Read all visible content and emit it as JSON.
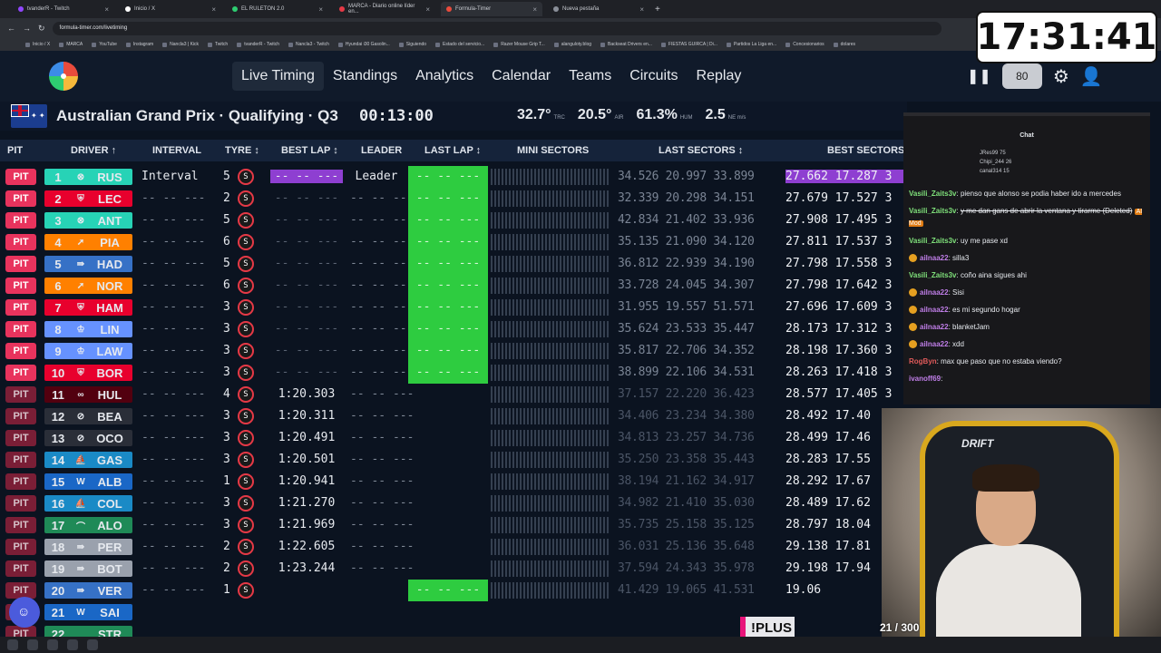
{
  "browser": {
    "tabs": [
      {
        "label": "tvanderR - Twitch",
        "color": "#9146ff",
        "active": false
      },
      {
        "label": "Inicio / X",
        "color": "#ffffff",
        "active": false
      },
      {
        "label": "EL RULETON 2.0",
        "color": "#2ecc71",
        "active": false
      },
      {
        "label": "MARCA - Diario online líder en...",
        "color": "#e63946",
        "active": false
      },
      {
        "label": "Formula-Timer",
        "color": "#e94b3c",
        "active": true
      },
      {
        "label": "Nueva pestaña",
        "color": "#8a8f99",
        "active": false
      }
    ],
    "url": "formula-timer.com/livetiming",
    "bookmarks": [
      "Inicio / X",
      "MARCA",
      "YouTube",
      "Instagram",
      "Nancla3 | Kick",
      "Twitch",
      "tvanderR - Twitch",
      "Nancla3 - Twitch",
      "Hyundai i30 Gasolin...",
      "Siguiendo",
      "Estado del servicio...",
      "Razer Mouse Grip T...",
      "alanguloty.blog",
      "Backseat Drivers en...",
      "FIESTAS GUIRCA | Di...",
      "Partidos La Liga en...",
      "Concesionarios",
      "dolares"
    ]
  },
  "nav": {
    "links": [
      "Live Timing",
      "Standings",
      "Analytics",
      "Calendar",
      "Teams",
      "Circuits",
      "Replay"
    ],
    "speed": "80"
  },
  "overlay_clock": "17:31:41",
  "session": {
    "title": "Australian Grand Prix · Qualifying · Q3",
    "time": "00:13:00",
    "track_temp": "32.7°",
    "track_label": "TRC",
    "air_temp": "20.5°",
    "air_label": "AIR",
    "humidity": "61.3%",
    "hum_label": "HUM",
    "wind": "2.5",
    "wind_label": "NE m/s"
  },
  "table": {
    "headers": [
      "PIT",
      "DRIVER ↑",
      "INTERVAL",
      "TYRE ↕",
      "BEST LAP ↕",
      "LEADER",
      "LAST LAP ↕",
      "MINI SECTORS",
      "LAST SECTORS ↕",
      "BEST SECTORS"
    ],
    "rows": [
      {
        "pit": "PIT",
        "pos": "1",
        "team_icon": "⊗",
        "abbr": "RUS",
        "color": "#27d3b6",
        "interval": "Interval",
        "tyre": "5",
        "best": "-- -- ---",
        "best_purple": true,
        "leader": "Leader",
        "last": "-- -- ---",
        "last_green": true,
        "ls": "34.526 20.997 33.899",
        "bs": "27.662 17.287 3",
        "bs_purple": true
      },
      {
        "pit": "PIT",
        "pos": "2",
        "team_icon": "⛨",
        "abbr": "LEC",
        "color": "#e8002d",
        "interval": "-- -- ---",
        "tyre": "2",
        "best": "-- -- ---",
        "leader": "-- -- ---",
        "last": "-- -- ---",
        "last_green": true,
        "ls": "32.339 20.298 34.151",
        "bs": "27.679 17.527 3"
      },
      {
        "pit": "PIT",
        "pos": "3",
        "team_icon": "⊗",
        "abbr": "ANT",
        "color": "#27d3b6",
        "interval": "-- -- ---",
        "tyre": "5",
        "best": "-- -- ---",
        "leader": "-- -- ---",
        "last": "-- -- ---",
        "last_green": true,
        "ls": "42.834 21.402 33.936",
        "bs": "27.908 17.495 3"
      },
      {
        "pit": "PIT",
        "pos": "4",
        "team_icon": "➚",
        "abbr": "PIA",
        "color": "#ff8000",
        "interval": "-- -- ---",
        "tyre": "6",
        "best": "-- -- ---",
        "leader": "-- -- ---",
        "last": "-- -- ---",
        "last_green": true,
        "ls": "35.135 21.090 34.120",
        "bs": "27.811 17.537 3"
      },
      {
        "pit": "PIT",
        "pos": "5",
        "team_icon": "⇛",
        "abbr": "HAD",
        "color": "#3671c6",
        "interval": "-- -- ---",
        "tyre": "5",
        "best": "-- -- ---",
        "leader": "-- -- ---",
        "last": "-- -- ---",
        "last_green": true,
        "ls": "36.812 22.939 34.190",
        "bs": "27.798 17.558 3"
      },
      {
        "pit": "PIT",
        "pos": "6",
        "team_icon": "➚",
        "abbr": "NOR",
        "color": "#ff8000",
        "interval": "-- -- ---",
        "tyre": "6",
        "best": "-- -- ---",
        "leader": "-- -- ---",
        "last": "-- -- ---",
        "last_green": true,
        "ls": "33.728 24.045 34.307",
        "bs": "27.798 17.642 3"
      },
      {
        "pit": "PIT",
        "pos": "7",
        "team_icon": "⛨",
        "abbr": "HAM",
        "color": "#e8002d",
        "interval": "-- -- ---",
        "tyre": "3",
        "best": "-- -- ---",
        "leader": "-- -- ---",
        "last": "-- -- ---",
        "last_green": true,
        "ls": "31.955 19.557 51.571",
        "bs": "27.696 17.609 3"
      },
      {
        "pit": "PIT",
        "pos": "8",
        "team_icon": "♔",
        "abbr": "LIN",
        "color": "#6692ff",
        "interval": "-- -- ---",
        "tyre": "3",
        "best": "-- -- ---",
        "leader": "-- -- ---",
        "last": "-- -- ---",
        "last_green": true,
        "ls": "35.624 23.533 35.447",
        "bs": "28.173 17.312 3"
      },
      {
        "pit": "PIT",
        "pos": "9",
        "team_icon": "♔",
        "abbr": "LAW",
        "color": "#6692ff",
        "interval": "-- -- ---",
        "tyre": "3",
        "best": "-- -- ---",
        "leader": "-- -- ---",
        "last": "-- -- ---",
        "last_green": true,
        "ls": "35.817 22.706 34.352",
        "bs": "28.198 17.360 3"
      },
      {
        "pit": "PIT",
        "pos": "10",
        "team_icon": "⛨",
        "abbr": "BOR",
        "color": "#e8002d",
        "interval": "-- -- ---",
        "tyre": "3",
        "best": "-- -- ---",
        "leader": "-- -- ---",
        "last": "-- -- ---",
        "last_green": true,
        "ls": "38.899 22.106 34.531",
        "bs": "28.263 17.418 3"
      },
      {
        "pit": "PIT",
        "pos": "11",
        "team_icon": "∞",
        "abbr": "HUL",
        "color": "#52000f",
        "interval": "-- -- ---",
        "tyre": "4",
        "best": "1:20.303",
        "leader": "-- -- ---",
        "last": "",
        "ls": "37.157 22.220 36.423",
        "bs": "28.577 17.405 3",
        "dim": true
      },
      {
        "pit": "PIT",
        "pos": "12",
        "team_icon": "⊘",
        "abbr": "BEA",
        "color": "#2a2e38",
        "interval": "-- -- ---",
        "tyre": "3",
        "best": "1:20.311",
        "leader": "-- -- ---",
        "last": "",
        "ls": "34.406 23.234 34.380",
        "bs": "28.492 17.40",
        "dim": true
      },
      {
        "pit": "PIT",
        "pos": "13",
        "team_icon": "⊘",
        "abbr": "OCO",
        "color": "#2a2e38",
        "interval": "-- -- ---",
        "tyre": "3",
        "best": "1:20.491",
        "leader": "-- -- ---",
        "last": "",
        "ls": "34.813 23.257 34.736",
        "bs": "28.499 17.46",
        "dim": true
      },
      {
        "pit": "PIT",
        "pos": "14",
        "team_icon": "⛵",
        "abbr": "GAS",
        "color": "#1a8ac6",
        "interval": "-- -- ---",
        "tyre": "3",
        "best": "1:20.501",
        "leader": "-- -- ---",
        "last": "",
        "ls": "35.250 23.358 35.443",
        "bs": "28.283 17.55",
        "dim": true
      },
      {
        "pit": "PIT",
        "pos": "15",
        "team_icon": "W",
        "abbr": "ALB",
        "color": "#1a67c6",
        "interval": "-- -- ---",
        "tyre": "1",
        "best": "1:20.941",
        "leader": "-- -- ---",
        "last": "",
        "ls": "38.194 21.162 34.917",
        "bs": "28.292 17.67",
        "dim": true
      },
      {
        "pit": "PIT",
        "pos": "16",
        "team_icon": "⛵",
        "abbr": "COL",
        "color": "#1a8ac6",
        "interval": "-- -- ---",
        "tyre": "3",
        "best": "1:21.270",
        "leader": "-- -- ---",
        "last": "",
        "ls": "34.982 21.410 35.030",
        "bs": "28.489 17.62",
        "dim": true
      },
      {
        "pit": "PIT",
        "pos": "17",
        "team_icon": "⌒",
        "abbr": "ALO",
        "color": "#1f8a57",
        "interval": "-- -- ---",
        "tyre": "3",
        "best": "1:21.969",
        "leader": "-- -- ---",
        "last": "",
        "ls": "35.735 25.158 35.125",
        "bs": "28.797 18.04",
        "dim": true
      },
      {
        "pit": "PIT",
        "pos": "18",
        "team_icon": "⇛",
        "abbr": "PER",
        "color": "#9aa1ad",
        "interval": "-- -- ---",
        "tyre": "2",
        "best": "1:22.605",
        "leader": "-- -- ---",
        "last": "",
        "ls": "36.031 25.136 35.648",
        "bs": "29.138 17.81",
        "dim": true
      },
      {
        "pit": "PIT",
        "pos": "19",
        "team_icon": "⇛",
        "abbr": "BOT",
        "color": "#9aa1ad",
        "interval": "-- -- ---",
        "tyre": "2",
        "best": "1:23.244",
        "leader": "-- -- ---",
        "last": "",
        "ls": "37.594 24.343 35.978",
        "bs": "29.198 17.94",
        "dim": true
      },
      {
        "pit": "PIT",
        "pos": "20",
        "team_icon": "⇛",
        "abbr": "VER",
        "color": "#3671c6",
        "interval": "-- -- ---",
        "tyre": "1",
        "best": "",
        "leader": "",
        "last": "-- -- ---",
        "last_green": true,
        "ls": "41.429 19.065 41.531",
        "bs": "19.06",
        "dim": true
      },
      {
        "pit": "PIT",
        "pos": "21",
        "team_icon": "W",
        "abbr": "SAI",
        "color": "#1a67c6",
        "interval": "",
        "tyre": "",
        "best": "",
        "leader": "",
        "last": "",
        "ls": "",
        "bs": "",
        "dim": true
      },
      {
        "pit": "PIT",
        "pos": "22",
        "team_icon": "",
        "abbr": "STR",
        "color": "#1f8a57",
        "interval": "",
        "tyre": "",
        "best": "",
        "leader": "",
        "last": "",
        "ls": "",
        "bs": "",
        "dim": true
      }
    ]
  },
  "chat": {
    "title": "Chat",
    "top_viewers": [
      "JRes99 75",
      "Chipi_244 26",
      "canal314 15"
    ],
    "messages": [
      {
        "user": "Vasili_Zaits3v",
        "text": "pienso que alonso se podia haber ido a mercedes",
        "color": "#7fe07a",
        "deleted": false
      },
      {
        "user": "Vasili_Zaits3v",
        "text": "y me dan gans de abrir la ventana y tirarme (Deleted)",
        "color": "#7fe07a",
        "deleted": true,
        "mod": "AI Mod"
      },
      {
        "user": "Vasili_Zaits3v",
        "text": "uy me pase xd",
        "color": "#7fe07a",
        "deleted": false
      },
      {
        "user": "ailnaa22",
        "text": "silla3",
        "color": "#c07ee8",
        "deleted": false,
        "badge": true
      },
      {
        "user": "Vasili_Zaits3v",
        "text": "coño aina sigues ahi",
        "color": "#7fe07a",
        "deleted": false
      },
      {
        "user": "ailnaa22",
        "text": "Sisi",
        "color": "#c07ee8",
        "deleted": false,
        "badge": true
      },
      {
        "user": "ailnaa22",
        "text": "es mi segundo hogar",
        "color": "#c07ee8",
        "deleted": false,
        "badge": true
      },
      {
        "user": "ailnaa22",
        "text": "blanketJam",
        "color": "#c07ee8",
        "deleted": false,
        "badge": true
      },
      {
        "user": "ailnaa22",
        "text": "xdd",
        "color": "#c07ee8",
        "deleted": false,
        "badge": true
      },
      {
        "user": "RogByn",
        "text": "max que paso que no estaba viendo?",
        "color": "#e05a5a",
        "deleted": false
      },
      {
        "user": "ivanoff69",
        "text": "",
        "color": "#c07ee8",
        "deleted": false
      }
    ]
  },
  "webcam": {
    "chair_text": "DRIFT"
  },
  "stream_overlay": {
    "plus": "!PLUS",
    "counter": "21 / 300"
  },
  "colors": {
    "pit": "#e8335d",
    "green": "#2ecc40",
    "purple": "#8e3fd1",
    "bg": "#0b1320"
  }
}
